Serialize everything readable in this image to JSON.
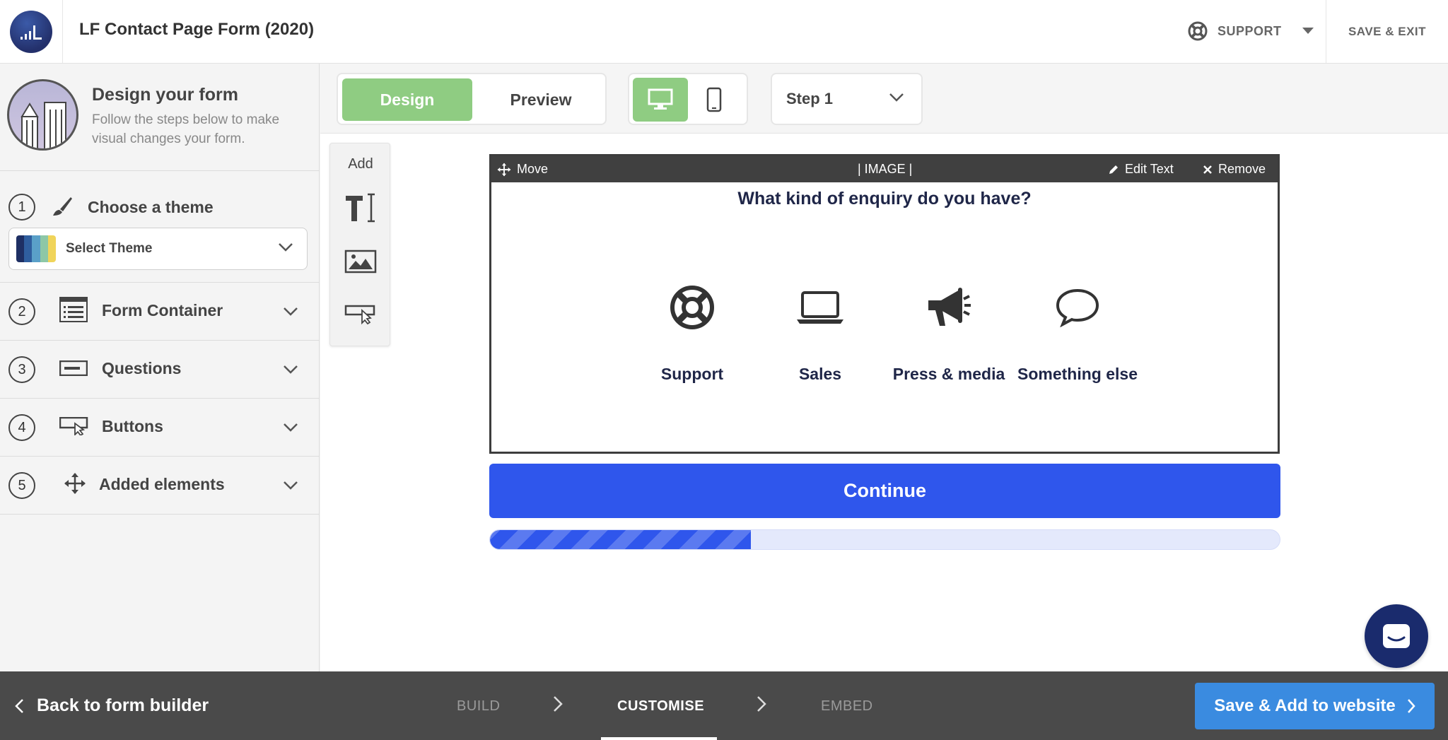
{
  "header": {
    "form_title": "LF Contact Page Form (2020)",
    "support_label": "SUPPORT",
    "save_exit_label": "SAVE & EXIT"
  },
  "sidebar": {
    "title": "Design your form",
    "subtitle": "Follow the steps below to make visual changes your form.",
    "steps": [
      {
        "num": "1",
        "label": "Choose a theme",
        "icon": "brush-icon"
      },
      {
        "num": "2",
        "label": "Form Container",
        "icon": "list-icon"
      },
      {
        "num": "3",
        "label": "Questions",
        "icon": "input-icon"
      },
      {
        "num": "4",
        "label": "Buttons",
        "icon": "button-cursor-icon"
      },
      {
        "num": "5",
        "label": "Added elements",
        "icon": "move-icon"
      }
    ],
    "theme_select_label": "Select Theme",
    "theme_swatches": [
      "#1e2f63",
      "#2f5e9e",
      "#5aa0c8",
      "#8dc7a6",
      "#f0d45a"
    ]
  },
  "toolbar": {
    "design_label": "Design",
    "preview_label": "Preview",
    "step_select_label": "Step 1"
  },
  "add_panel": {
    "title": "Add"
  },
  "form": {
    "bar_move": "Move",
    "bar_image": "| IMAGE |",
    "bar_edit": "Edit Text",
    "bar_remove": "Remove",
    "question": "What kind of enquiry do you have?",
    "choices": [
      {
        "label": "Support",
        "icon": "lifebuoy-icon"
      },
      {
        "label": "Sales",
        "icon": "laptop-icon"
      },
      {
        "label": "Press & media",
        "icon": "megaphone-icon"
      },
      {
        "label": "Something else",
        "icon": "speech-bubble-icon"
      }
    ],
    "continue_label": "Continue",
    "progress_percent": 33
  },
  "footer": {
    "back_label": "Back to form builder",
    "steps": [
      "BUILD",
      "CUSTOMISE",
      "EMBED"
    ],
    "active_step": "CUSTOMISE",
    "save_add_label": "Save & Add to website"
  },
  "colors": {
    "accent_green": "#8fcc82",
    "primary_blue": "#2f56ec",
    "cta_blue": "#3a8be0",
    "dark_navy": "#1f2648",
    "bottom_bar": "#4a4a4a"
  }
}
